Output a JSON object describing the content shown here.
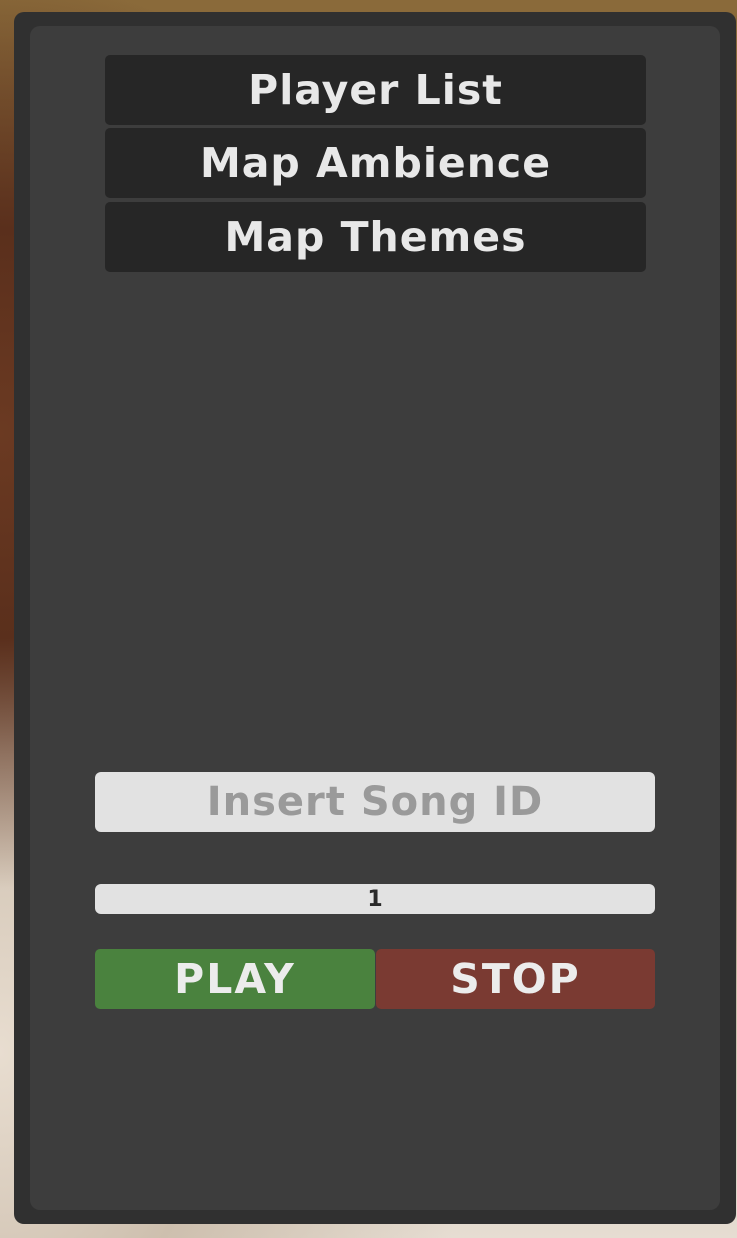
{
  "menu": {
    "player_list_label": "Player List",
    "map_ambience_label": "Map Ambience",
    "map_themes_label": "Map Themes"
  },
  "song": {
    "placeholder": "Insert Song ID",
    "value": ""
  },
  "volume": {
    "value": "1"
  },
  "controls": {
    "play_label": "PLAY",
    "stop_label": "STOP"
  },
  "colors": {
    "panel": "#3d3d3d",
    "frame": "#303030",
    "menu_button": "#262626",
    "play": "#4a823e",
    "stop": "#7a3a32",
    "input": "#e2e2e2"
  }
}
